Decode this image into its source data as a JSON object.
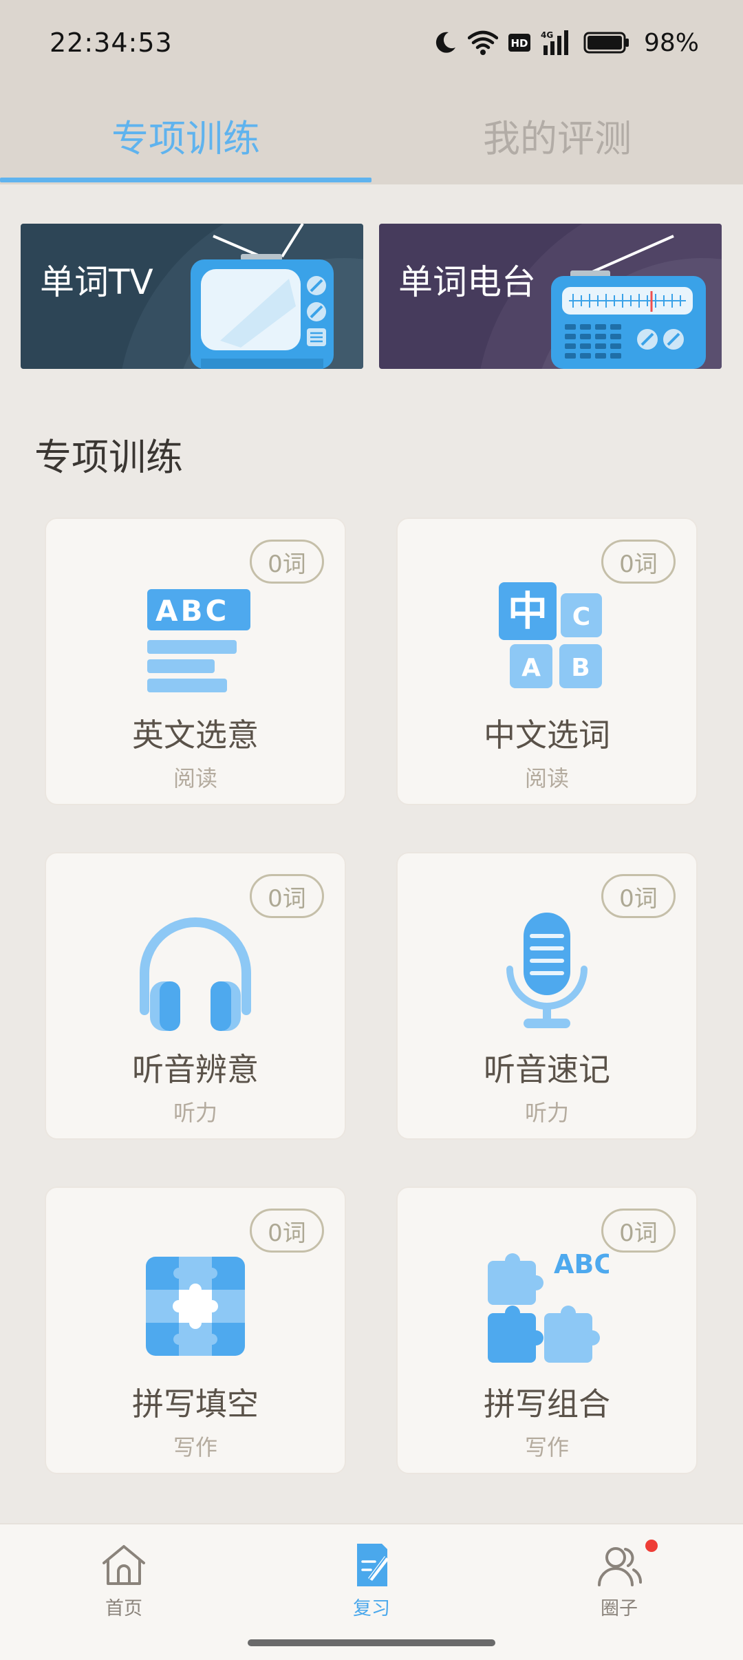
{
  "status_bar": {
    "time": "22:34:53",
    "hd_label": "HD",
    "net_label": "4G",
    "battery": "98%"
  },
  "tabs": [
    {
      "label": "专项训练",
      "active": true
    },
    {
      "label": "我的评测",
      "active": false
    }
  ],
  "banners": [
    {
      "label": "单词TV",
      "icon": "tv-icon"
    },
    {
      "label": "单词电台",
      "icon": "radio-icon"
    }
  ],
  "section": {
    "title": "专项训练"
  },
  "cards": [
    {
      "title": "英文选意",
      "sub": "阅读",
      "badge": "0词",
      "icon": "abc-lines-icon"
    },
    {
      "title": "中文选词",
      "sub": "阅读",
      "badge": "0词",
      "icon": "chinese-blocks-icon"
    },
    {
      "title": "听音辨意",
      "sub": "听力",
      "badge": "0词",
      "icon": "headphones-icon"
    },
    {
      "title": "听音速记",
      "sub": "听力",
      "badge": "0词",
      "icon": "microphone-icon"
    },
    {
      "title": "拼写填空",
      "sub": "写作",
      "badge": "0词",
      "icon": "puzzle-grid-icon"
    },
    {
      "title": "拼写组合",
      "sub": "写作",
      "badge": "0词",
      "icon": "puzzle-abc-icon"
    }
  ],
  "icon_text": {
    "abc": "ABC",
    "zhong": "中",
    "c": "C",
    "a": "A",
    "b": "B"
  },
  "bottom_nav": [
    {
      "label": "首页",
      "icon": "home-icon",
      "active": false
    },
    {
      "label": "复习",
      "icon": "review-icon",
      "active": true
    },
    {
      "label": "圈子",
      "icon": "people-icon",
      "active": false
    }
  ],
  "colors": {
    "accent": "#5fb3ee",
    "tab_inactive": "#b2aca6",
    "badge_border": "#c5bfa9",
    "notification": "#ee3d36"
  }
}
